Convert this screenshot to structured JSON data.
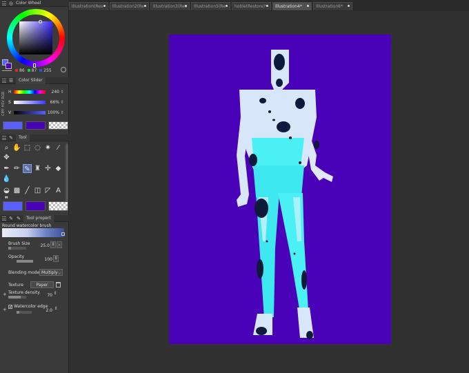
{
  "panels": {
    "color_wheel_title": "Color Wheel",
    "color_slider_title": "Color Slider",
    "tool_title": "Tool",
    "tool_property_title": "Tool propert"
  },
  "color_wheel": {
    "r": "86",
    "g": "87",
    "b": "255"
  },
  "color_slider": {
    "side_tabs": "CMY HSV RGB",
    "rows": [
      {
        "label": "H",
        "value": "240"
      },
      {
        "label": "S",
        "value": "66%"
      },
      {
        "label": "V",
        "value": "100%"
      }
    ]
  },
  "colors": {
    "main": "#5a5fff",
    "sub": "#4a02b8",
    "canvas_bg": "#4a02b8",
    "figure_light": "#d8e6fa",
    "figure_cyan": "#3fe8f0",
    "spots": "#0e1a3a"
  },
  "tool_property": {
    "brush_name": "Round watercolor brush",
    "brush_size_label": "Brush Size",
    "brush_size_value": "25.0",
    "opacity_label": "Opacity",
    "opacity_value": "100",
    "blending_label": "Blending mode",
    "blending_value": "Multiply",
    "texture_label": "Texture",
    "texture_value": "Paper",
    "texture_density_label": "Texture density",
    "texture_density_value": "70",
    "watercolor_edge_label": "Watercolor edge",
    "watercolor_edge_value": "2.0"
  },
  "tabs": [
    {
      "label": "Illustration(Res"
    },
    {
      "label": "Illustration2(Re"
    },
    {
      "label": "Illustration3(Res"
    },
    {
      "label": "Illustration5(Re"
    },
    {
      "label": "hoble(Restore)*"
    },
    {
      "label": "Illustration4*"
    },
    {
      "label": "Illustration6*"
    }
  ]
}
